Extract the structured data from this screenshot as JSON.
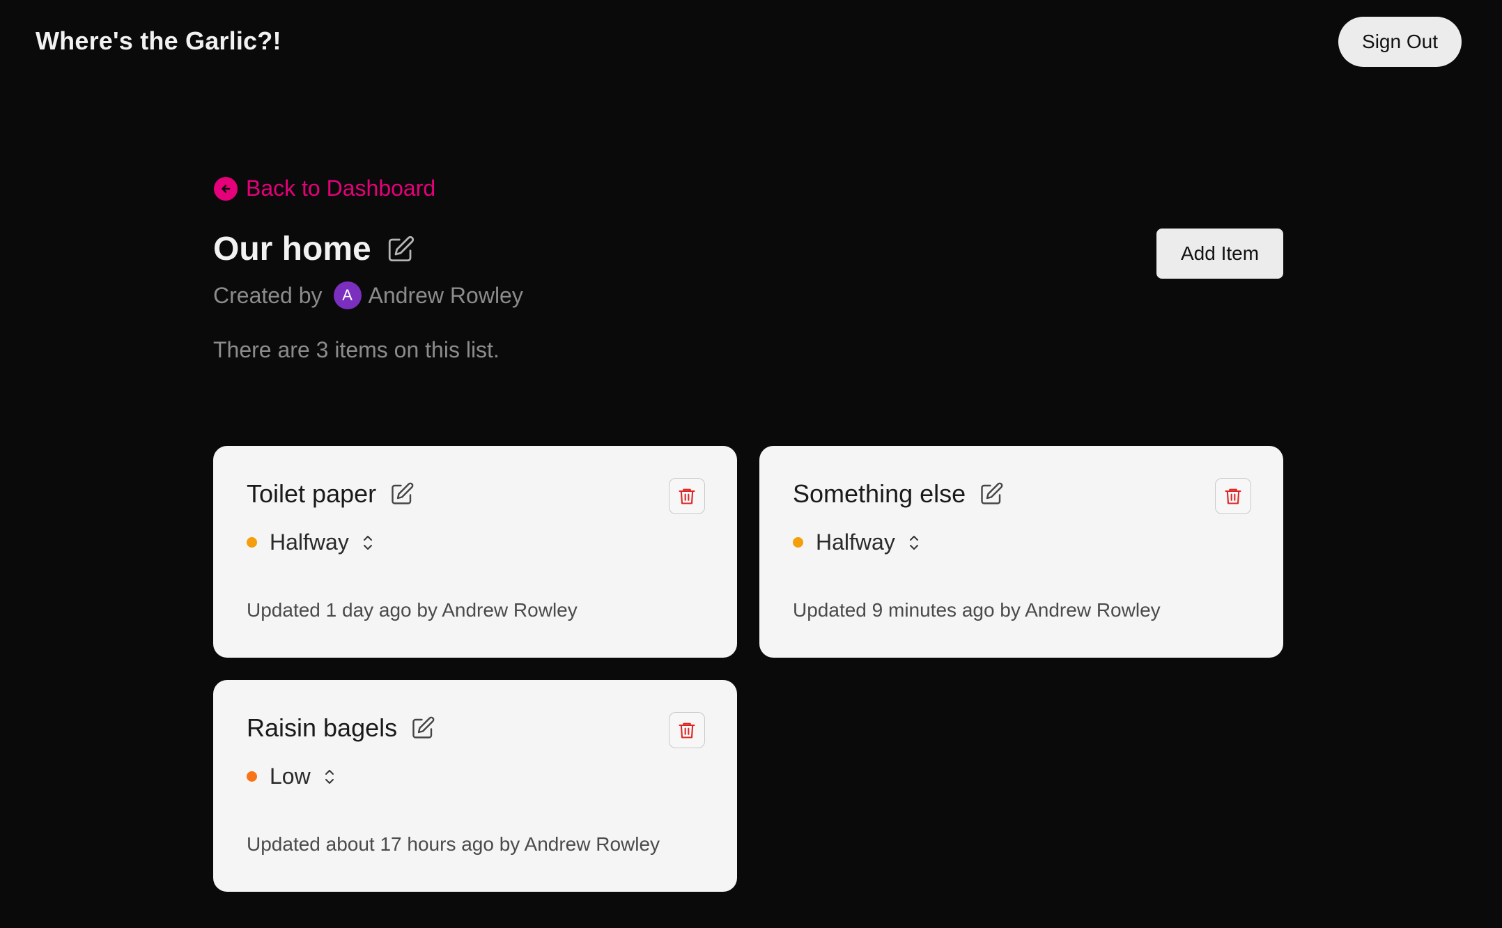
{
  "app": {
    "title": "Where's the Garlic?!",
    "sign_out_label": "Sign Out"
  },
  "nav": {
    "back_label": "Back to Dashboard"
  },
  "list": {
    "title": "Our home",
    "created_by_prefix": "Created by",
    "creator_initial": "A",
    "creator_name": "Andrew Rowley",
    "count_text": "There are 3 items on this list.",
    "add_item_label": "Add Item"
  },
  "items": [
    {
      "name": "Toilet paper",
      "status": "Halfway",
      "updated": "Updated 1 day ago by Andrew Rowley"
    },
    {
      "name": "Something else",
      "status": "Halfway",
      "updated": "Updated 9 minutes ago by Andrew Rowley"
    },
    {
      "name": "Raisin bagels",
      "status": "Low",
      "updated": "Updated about 17 hours ago by Andrew Rowley"
    }
  ],
  "colors": {
    "background": "#0a0a0a",
    "accent": "#e6007a",
    "avatar": "#7b2fbf",
    "status_halfway": "#f59e0b",
    "status_low": "#f97316",
    "danger": "#dc2626"
  },
  "icons": {
    "back": "arrow-left-circle-icon",
    "edit": "pencil-square-icon",
    "delete": "trash-icon",
    "status_toggle": "chevron-up-down-icon"
  }
}
